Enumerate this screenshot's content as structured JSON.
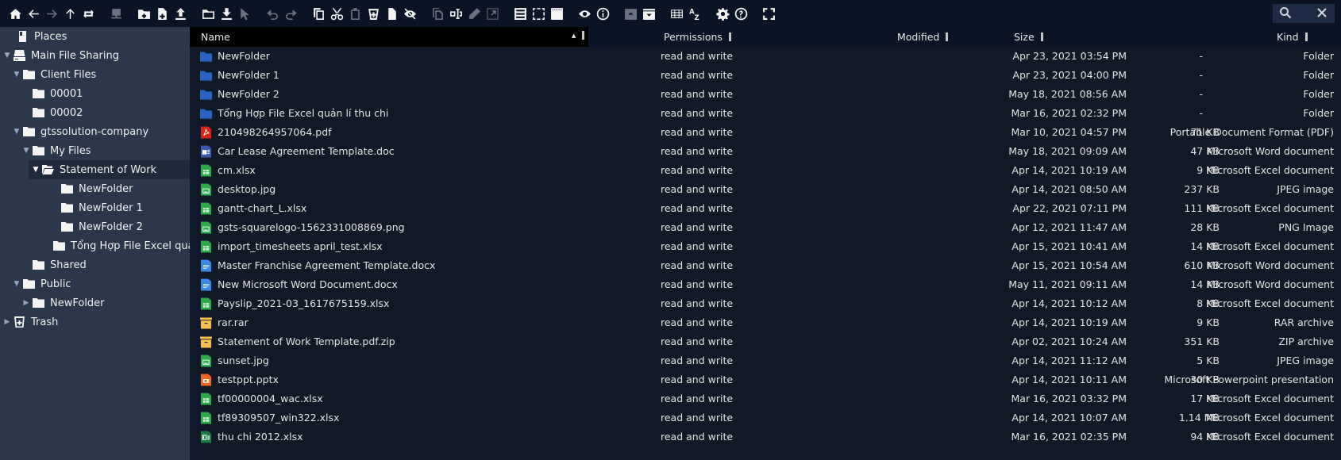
{
  "toolbar": {
    "groups": [
      [
        {
          "icon": "home-icon",
          "enabled": true
        },
        {
          "icon": "back-arrow-icon",
          "enabled": true
        },
        {
          "icon": "forward-arrow-icon",
          "enabled": false
        },
        {
          "icon": "up-arrow-icon",
          "enabled": true
        },
        {
          "icon": "refresh-icon",
          "enabled": true
        }
      ],
      [
        {
          "icon": "network-drive-icon",
          "enabled": false
        }
      ],
      [
        {
          "icon": "new-folder-icon",
          "enabled": true
        },
        {
          "icon": "new-file-icon",
          "enabled": true
        },
        {
          "icon": "upload-icon",
          "enabled": true
        }
      ],
      [
        {
          "icon": "open-folder-icon",
          "enabled": true
        },
        {
          "icon": "download-icon",
          "enabled": true
        },
        {
          "icon": "select-cursor-icon",
          "enabled": false
        }
      ],
      [
        {
          "icon": "undo-icon",
          "enabled": false
        },
        {
          "icon": "redo-icon",
          "enabled": false
        }
      ],
      [
        {
          "icon": "copy-icon",
          "enabled": true
        },
        {
          "icon": "cut-icon",
          "enabled": true
        },
        {
          "icon": "paste-icon",
          "enabled": false
        },
        {
          "icon": "delete-icon",
          "enabled": true
        },
        {
          "icon": "file-icon",
          "enabled": true
        },
        {
          "icon": "hide-icon",
          "enabled": true
        }
      ],
      [
        {
          "icon": "duplicate-icon",
          "enabled": false
        },
        {
          "icon": "rename-icon",
          "enabled": true
        },
        {
          "icon": "edit-pencil-icon",
          "enabled": false
        },
        {
          "icon": "resize-icon",
          "enabled": false
        }
      ],
      [
        {
          "icon": "select-all-icon",
          "enabled": true
        },
        {
          "icon": "select-none-icon",
          "enabled": true
        },
        {
          "icon": "invert-selection-icon",
          "enabled": true
        }
      ],
      [
        {
          "icon": "preview-eye-icon",
          "enabled": true
        },
        {
          "icon": "info-icon",
          "enabled": true
        }
      ],
      [
        {
          "icon": "archive-compress-icon",
          "enabled": false
        },
        {
          "icon": "archive-extract-icon",
          "enabled": true
        }
      ],
      [
        {
          "icon": "grid-view-icon",
          "enabled": true
        },
        {
          "icon": "sort-az-icon",
          "enabled": true
        }
      ],
      [
        {
          "icon": "settings-gear-icon",
          "enabled": true
        },
        {
          "icon": "help-icon",
          "enabled": true
        }
      ],
      [
        {
          "icon": "fullscreen-icon",
          "enabled": true
        }
      ]
    ],
    "search": {
      "icon": "search-icon",
      "close_icon": "close-icon"
    }
  },
  "sidebar": {
    "items": [
      {
        "label": "Places",
        "icon": "places-icon",
        "caret": "",
        "level": 0,
        "selected": false
      },
      {
        "label": "Main File Sharing",
        "icon": "drive-icon",
        "caret": "down",
        "level": 0,
        "selected": false
      },
      {
        "label": "Client Files",
        "icon": "folder-icon",
        "caret": "down",
        "level": 1,
        "selected": false
      },
      {
        "label": "00001",
        "icon": "folder-icon",
        "caret": "",
        "level": 2,
        "selected": false
      },
      {
        "label": "00002",
        "icon": "folder-icon",
        "caret": "",
        "level": 2,
        "selected": false
      },
      {
        "label": "gtssolution-company",
        "icon": "folder-icon",
        "caret": "down",
        "level": 1,
        "selected": false
      },
      {
        "label": "My Files",
        "icon": "folder-icon",
        "caret": "down",
        "level": 2,
        "selected": false
      },
      {
        "label": "Statement of Work",
        "icon": "folder-open-icon",
        "caret": "down",
        "level": 3,
        "selected": true
      },
      {
        "label": "NewFolder",
        "icon": "folder-icon",
        "caret": "",
        "level": 4,
        "selected": false
      },
      {
        "label": "NewFolder 1",
        "icon": "folder-icon",
        "caret": "",
        "level": 4,
        "selected": false
      },
      {
        "label": "NewFolder 2",
        "icon": "folder-icon",
        "caret": "",
        "level": 4,
        "selected": false
      },
      {
        "label": "Tổng Hợp File Excel quản lí thu chi",
        "icon": "folder-icon",
        "caret": "",
        "level": 4,
        "selected": false
      },
      {
        "label": "Shared",
        "icon": "folder-icon",
        "caret": "",
        "level": 2,
        "selected": false
      },
      {
        "label": "Public",
        "icon": "folder-icon",
        "caret": "down",
        "level": 1,
        "selected": false
      },
      {
        "label": "NewFolder",
        "icon": "folder-icon",
        "caret": "right",
        "level": 2,
        "selected": false
      },
      {
        "label": "Trash",
        "icon": "trash-icon",
        "caret": "right",
        "level": 0,
        "selected": false
      }
    ]
  },
  "table": {
    "columns": {
      "name": "Name",
      "permissions": "Permissions",
      "modified": "Modified",
      "size": "Size",
      "kind": "Kind"
    },
    "sort_indicator": "▲",
    "rows": [
      {
        "name": "NewFolder",
        "type": "folder",
        "permissions": "read and write",
        "modified": "Apr 23, 2021 03:54 PM",
        "size": "-",
        "kind": "Folder"
      },
      {
        "name": "NewFolder 1",
        "type": "folder",
        "permissions": "read and write",
        "modified": "Apr 23, 2021 04:00 PM",
        "size": "-",
        "kind": "Folder"
      },
      {
        "name": "NewFolder 2",
        "type": "folder",
        "permissions": "read and write",
        "modified": "May 18, 2021 08:56 AM",
        "size": "-",
        "kind": "Folder"
      },
      {
        "name": "Tổng Hợp File Excel quản lí thu chi",
        "type": "folder",
        "permissions": "read and write",
        "modified": "Mar 16, 2021 02:32 PM",
        "size": "-",
        "kind": "Folder"
      },
      {
        "name": "210498264957064.pdf",
        "type": "pdf",
        "permissions": "read and write",
        "modified": "Mar 10, 2021 04:57 PM",
        "size": "71 KB",
        "kind": "Portable Document Format (PDF)"
      },
      {
        "name": "Car Lease Agreement Template.doc",
        "type": "doc",
        "permissions": "read and write",
        "modified": "May 18, 2021 09:09 AM",
        "size": "47 KB",
        "kind": "Microsoft Word document"
      },
      {
        "name": "cm.xlsx",
        "type": "sheet",
        "permissions": "read and write",
        "modified": "Apr 14, 2021 10:19 AM",
        "size": "9 KB",
        "kind": "Microsoft Excel document"
      },
      {
        "name": "desktop.jpg",
        "type": "image",
        "permissions": "read and write",
        "modified": "Apr 14, 2021 08:50 AM",
        "size": "237 KB",
        "kind": "JPEG image"
      },
      {
        "name": "gantt-chart_L.xlsx",
        "type": "sheet",
        "permissions": "read and write",
        "modified": "Apr 22, 2021 07:11 PM",
        "size": "111 KB",
        "kind": "Microsoft Excel document"
      },
      {
        "name": "gsts-squarelogo-1562331008869.png",
        "type": "image",
        "permissions": "read and write",
        "modified": "Apr 12, 2021 11:47 AM",
        "size": "28 KB",
        "kind": "PNG Image"
      },
      {
        "name": "import_timesheets april_test.xlsx",
        "type": "sheet",
        "permissions": "read and write",
        "modified": "Apr 15, 2021 10:41 AM",
        "size": "14 KB",
        "kind": "Microsoft Excel document"
      },
      {
        "name": "Master Franchise Agreement Template.docx",
        "type": "docx",
        "permissions": "read and write",
        "modified": "Apr 15, 2021 10:54 AM",
        "size": "610 KB",
        "kind": "Microsoft Word document"
      },
      {
        "name": "New Microsoft Word Document.docx",
        "type": "docx",
        "permissions": "read and write",
        "modified": "May 11, 2021 09:11 AM",
        "size": "14 KB",
        "kind": "Microsoft Word document"
      },
      {
        "name": "Payslip_2021-03_1617675159.xlsx",
        "type": "sheet",
        "permissions": "read and write",
        "modified": "Apr 14, 2021 10:12 AM",
        "size": "8 KB",
        "kind": "Microsoft Excel document"
      },
      {
        "name": "rar.rar",
        "type": "archive",
        "permissions": "read and write",
        "modified": "Apr 14, 2021 10:19 AM",
        "size": "9 KB",
        "kind": "RAR archive"
      },
      {
        "name": "Statement of Work Template.pdf.zip",
        "type": "archive",
        "permissions": "read and write",
        "modified": "Apr 02, 2021 10:24 AM",
        "size": "351 KB",
        "kind": "ZIP archive"
      },
      {
        "name": "sunset.jpg",
        "type": "image",
        "permissions": "read and write",
        "modified": "Apr 14, 2021 11:12 AM",
        "size": "5 KB",
        "kind": "JPEG image"
      },
      {
        "name": "testppt.pptx",
        "type": "slides",
        "permissions": "read and write",
        "modified": "Apr 14, 2021 10:11 AM",
        "size": "30 KB",
        "kind": "Microsoft Powerpoint presentation"
      },
      {
        "name": "tf00000004_wac.xlsx",
        "type": "sheet",
        "permissions": "read and write",
        "modified": "Mar 16, 2021 03:32 PM",
        "size": "17 KB",
        "kind": "Microsoft Excel document"
      },
      {
        "name": "tf89309507_win322.xlsx",
        "type": "sheet",
        "permissions": "read and write",
        "modified": "Apr 14, 2021 10:07 AM",
        "size": "1.14 MB",
        "kind": "Microsoft Excel document"
      },
      {
        "name": "thu chi 2012.xlsx",
        "type": "excel",
        "permissions": "read and write",
        "modified": "Mar 16, 2021 02:35 PM",
        "size": "94 KB",
        "kind": "Microsoft Excel document"
      }
    ]
  },
  "colors": {
    "folder": "#2b63c4",
    "pdf": "#d8231b",
    "doc": "#3b5ba9",
    "docx": "#3a87e8",
    "sheet": "#2fa84f",
    "image": "#2fa84f",
    "archive": "#f3c24c",
    "slides": "#f26522",
    "excel": "#1d7a43"
  }
}
